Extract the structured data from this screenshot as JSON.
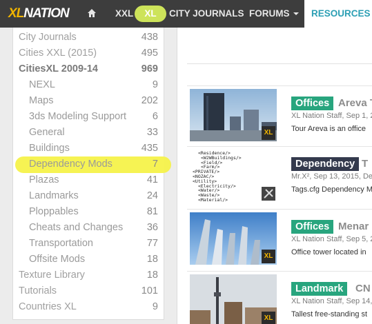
{
  "nav": {
    "logo_xl": "XL",
    "logo_nation": "NATION",
    "home_icon": "home-icon",
    "xxl": "XXL",
    "xl": "XL",
    "city_journals": "CITY JOURNALS",
    "forums": "FORUMS",
    "resources": "RESOURCES"
  },
  "sidebar": {
    "items": [
      {
        "label": "City Journals",
        "count": "438"
      },
      {
        "label": "Cities XXL (2015)",
        "count": "495"
      },
      {
        "label": "CitiesXL 2009-14",
        "count": "969"
      },
      {
        "label": "NEXL",
        "count": "9"
      },
      {
        "label": "Maps",
        "count": "202"
      },
      {
        "label": "3ds Modeling Support",
        "count": "6"
      },
      {
        "label": "General",
        "count": "33"
      },
      {
        "label": "Buildings",
        "count": "435"
      },
      {
        "label": "Dependency Mods",
        "count": "7"
      },
      {
        "label": "Plazas",
        "count": "41"
      },
      {
        "label": "Landmarks",
        "count": "24"
      },
      {
        "label": "Ploppables",
        "count": "81"
      },
      {
        "label": "Cheats and Changes",
        "count": "36"
      },
      {
        "label": "Transportation",
        "count": "77"
      },
      {
        "label": "Offsite Mods",
        "count": "18"
      },
      {
        "label": "Texture Library",
        "count": "18"
      },
      {
        "label": "Tutorials",
        "count": "101"
      },
      {
        "label": "Countries XL",
        "count": "9"
      }
    ],
    "highlight_color": "#f6f24a"
  },
  "cards": [
    {
      "tag": "Offices",
      "title_rest": "Areva T",
      "meta": "XL Nation Staff, Sep 1, 2",
      "desc": "Tour Areva is an office",
      "badge": "XL"
    },
    {
      "tag": "Dependency",
      "title_rest": "T",
      "meta": "Mr.X², Sep 13, 2015, De",
      "desc": "Tags.cfg Dependency M",
      "badge": ""
    },
    {
      "tag": "Offices",
      "title_rest": "Menar",
      "meta": "XL Nation Staff, Sep 5, 2",
      "desc": "Office tower located in",
      "badge": "XL"
    },
    {
      "tag": "Landmark",
      "title_rest": "CN",
      "meta": "XL Nation Staff, Sep 14,",
      "desc": "Tallest free-standing st",
      "badge": "XL"
    }
  ],
  "code_lines": [
    "<Residence/>",
    "<W2WBuildings/>",
    "<Field/>",
    "<Farm/>",
    "<PRIVATE/>",
    "<NOZAC/>",
    "<Utility>",
    "<Electricity/>",
    "<Water/>",
    "<Waste/>",
    "<Material/>"
  ],
  "colors": {
    "accent_green": "#28a57e",
    "accent_dark": "#343a4d",
    "nav_bg": "#3d3d3d",
    "resources_text": "#2c9fb4",
    "xl_pill": "#cde35a"
  }
}
